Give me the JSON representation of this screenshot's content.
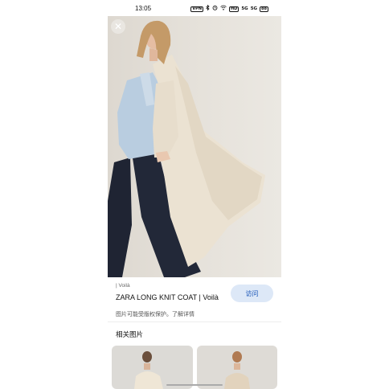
{
  "status_bar": {
    "time": "13:05",
    "icons": [
      "VPN",
      "bluetooth-icon",
      "alarm-icon",
      "wifi-icon",
      "HD",
      "5G",
      "5G",
      "battery-icon"
    ],
    "vpn_label": "VPN",
    "hd_label": "HD",
    "signal_1_label": "5G",
    "signal_2_label": "5G",
    "battery_label": "88"
  },
  "viewer": {
    "close_icon": "close-icon",
    "image_description": "model wearing long cream knit coat, blue shirt, dark jeans"
  },
  "info": {
    "source": "| Voilà",
    "title": "ZARA LONG KNIT COAT | Voilà",
    "notice": "图片可能受版权保护。了解详情",
    "visit_button": "访问"
  },
  "related": {
    "heading": "相关图片"
  },
  "colors": {
    "accent_button_bg": "#dde8f7",
    "accent_button_text": "#1a56b8",
    "photo_bg": "#e6e2db"
  }
}
